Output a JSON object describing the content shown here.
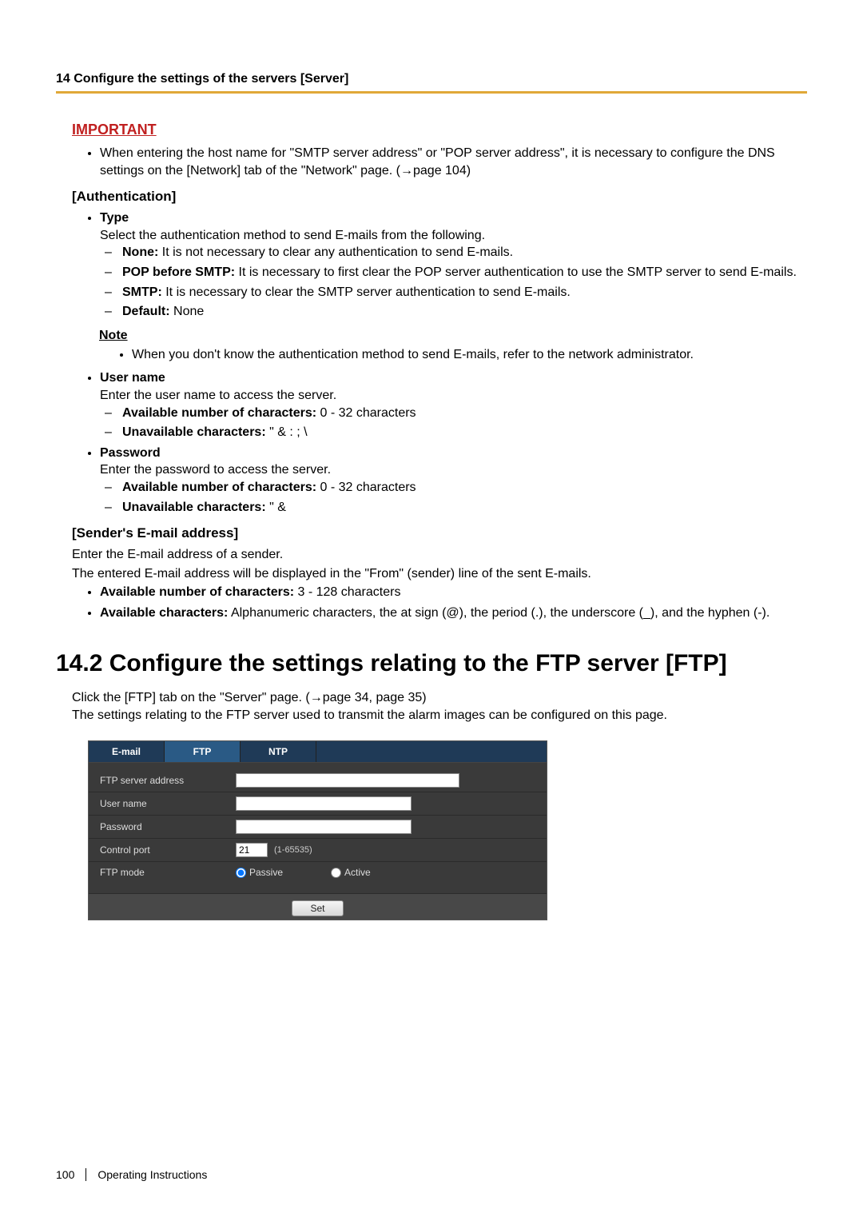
{
  "header": {
    "title": "14 Configure the settings of the servers [Server]"
  },
  "important": {
    "heading": "IMPORTANT",
    "item": "When entering the host name for \"SMTP server address\" or \"POP server address\", it is necessary to configure the DNS settings on the [Network] tab of the \"Network\" page. (→page 104)"
  },
  "auth": {
    "heading": "[Authentication]",
    "type_label": "Type",
    "type_desc": "Select the authentication method to send E-mails from the following.",
    "none": {
      "label": "None:",
      "text": " It is not necessary to clear any authentication to send E-mails."
    },
    "pop": {
      "label": "POP before SMTP:",
      "text": " It is necessary to first clear the POP server authentication to use the SMTP server to send E-mails."
    },
    "smtp": {
      "label": "SMTP:",
      "text": " It is necessary to clear the SMTP server authentication to send E-mails."
    },
    "default": {
      "label": "Default:",
      "text": " None"
    },
    "note_heading": "Note",
    "note_item": "When you don't know the authentication method to send E-mails, refer to the network administrator.",
    "user": {
      "label": "User name",
      "desc": "Enter the user name to access the server.",
      "chars": {
        "label": "Available number of characters:",
        "text": " 0 - 32 characters"
      },
      "unavail": {
        "label": "Unavailable characters:",
        "text": " \" & : ; \\"
      }
    },
    "pass": {
      "label": "Password",
      "desc": "Enter the password to access the server.",
      "chars": {
        "label": "Available number of characters:",
        "text": " 0 - 32 characters"
      },
      "unavail": {
        "label": "Unavailable characters:",
        "text": " \" &"
      }
    }
  },
  "sender": {
    "heading": "[Sender's E-mail address]",
    "line1": "Enter the E-mail address of a sender.",
    "line2": "The entered E-mail address will be displayed in the \"From\" (sender) line of the sent E-mails.",
    "chars": {
      "label": "Available number of characters:",
      "text": " 3 - 128 characters"
    },
    "avail": {
      "label": "Available characters:",
      "text": " Alphanumeric characters, the at sign (@), the period (.), the underscore (_), and the hyphen (-)."
    }
  },
  "h2": "14.2  Configure the settings relating to the FTP server [FTP]",
  "intro": {
    "line1": "Click the [FTP] tab on the \"Server\" page. (→page 34, page 35)",
    "line2": "The settings relating to the FTP server used to transmit the alarm images can be configured on this page."
  },
  "panel": {
    "tabs": {
      "email": "E-mail",
      "ftp": "FTP",
      "ntp": "NTP"
    },
    "rows": {
      "addr": "FTP server address",
      "user": "User name",
      "pass": "Password",
      "port": "Control port",
      "mode": "FTP mode"
    },
    "port_value": "21",
    "port_hint": "(1-65535)",
    "mode_passive": "Passive",
    "mode_active": "Active",
    "set": "Set"
  },
  "footer": {
    "page": "100",
    "doc": "Operating Instructions"
  }
}
